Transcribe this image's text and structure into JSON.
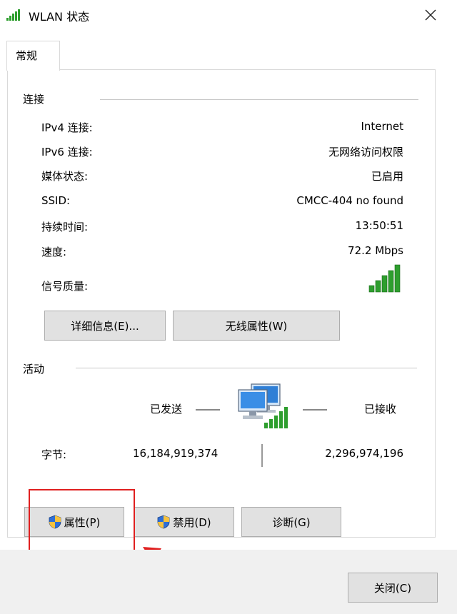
{
  "window": {
    "title": "WLAN 状态"
  },
  "tabs": [
    {
      "label": "常规"
    }
  ],
  "connection": {
    "group_label": "连接",
    "rows": [
      {
        "label": "IPv4 连接:",
        "value": "Internet"
      },
      {
        "label": "IPv6 连接:",
        "value": "无网络访问权限"
      },
      {
        "label": "媒体状态:",
        "value": "已启用"
      },
      {
        "label": "SSID:",
        "value": "CMCC-404 no found"
      },
      {
        "label": "持续时间:",
        "value": "13:50:51"
      },
      {
        "label": "速度:",
        "value": "72.2 Mbps"
      }
    ],
    "signal_label": "信号质量:",
    "signal_bars": 5,
    "details_button": "详细信息(E)...",
    "wireless_button": "无线属性(W)"
  },
  "activity": {
    "group_label": "活动",
    "sent_label": "已发送",
    "received_label": "已接收",
    "bytes_label": "字节:",
    "bytes_sent": "16,184,919,374",
    "bytes_received": "2,296,974,196"
  },
  "actions": {
    "properties_button": "属性(P)",
    "disable_button": "禁用(D)",
    "diagnose_button": "诊断(G)"
  },
  "footer": {
    "close_button": "关闭(C)"
  },
  "colors": {
    "signal_green": "#2e9e2e",
    "annotation_red": "#e02020",
    "button_face": "#e1e1e1"
  }
}
